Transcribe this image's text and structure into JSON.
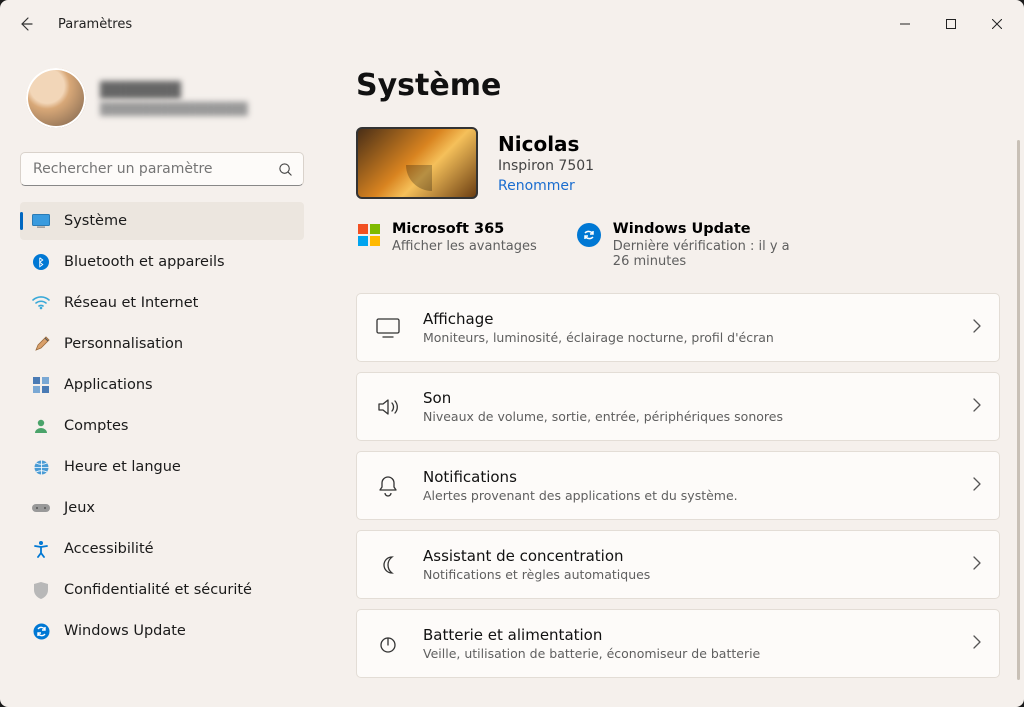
{
  "window": {
    "title": "Paramètres"
  },
  "profile": {
    "name": "███████",
    "email": "████████████████"
  },
  "search": {
    "placeholder": "Rechercher un paramètre"
  },
  "nav": [
    {
      "id": "systeme",
      "label": "Système",
      "selected": true
    },
    {
      "id": "bluetooth",
      "label": "Bluetooth et appareils"
    },
    {
      "id": "reseau",
      "label": "Réseau et Internet"
    },
    {
      "id": "personnalisation",
      "label": "Personnalisation"
    },
    {
      "id": "apps",
      "label": "Applications"
    },
    {
      "id": "comptes",
      "label": "Comptes"
    },
    {
      "id": "heure",
      "label": "Heure et langue"
    },
    {
      "id": "jeux",
      "label": "Jeux"
    },
    {
      "id": "accessibilite",
      "label": "Accessibilité"
    },
    {
      "id": "conf",
      "label": "Confidentialité et sécurité"
    },
    {
      "id": "wu",
      "label": "Windows Update"
    }
  ],
  "page": {
    "heading": "Système"
  },
  "device": {
    "name": "Nicolas",
    "model": "Inspiron 7501",
    "rename": "Renommer"
  },
  "status": {
    "ms365": {
      "title": "Microsoft 365",
      "sub": "Afficher les avantages"
    },
    "wu": {
      "title": "Windows Update",
      "sub": "Dernière vérification : il y a 26 minutes"
    }
  },
  "cards": [
    {
      "id": "affichage",
      "title": "Affichage",
      "sub": "Moniteurs, luminosité, éclairage nocturne, profil d'écran"
    },
    {
      "id": "son",
      "title": "Son",
      "sub": "Niveaux de volume, sortie, entrée, périphériques sonores"
    },
    {
      "id": "notifications",
      "title": "Notifications",
      "sub": "Alertes provenant des applications et du système."
    },
    {
      "id": "focus",
      "title": "Assistant de concentration",
      "sub": "Notifications et règles automatiques"
    },
    {
      "id": "batterie",
      "title": "Batterie et alimentation",
      "sub": "Veille, utilisation de batterie, économiseur de batterie"
    }
  ]
}
